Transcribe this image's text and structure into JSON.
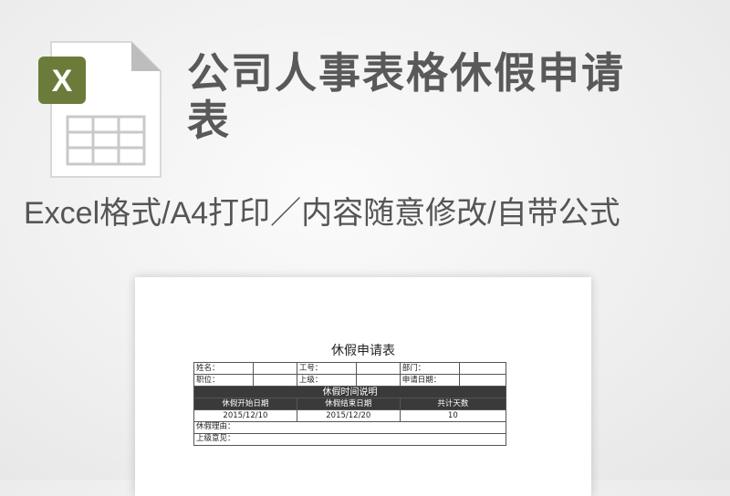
{
  "title": "公司人事表格休假申请表",
  "subtitle": "Excel格式/A4打印／内容随意修改/自带公式",
  "icon": {
    "letter": "X",
    "badge_color": "#6b7c3a"
  },
  "form": {
    "title": "休假申请表",
    "row1": {
      "name": "姓名：",
      "id": "工号：",
      "dept": "部门："
    },
    "row2": {
      "position": "职位：",
      "superior": "上级：",
      "apply_date": "申请日期："
    },
    "section": "休假时间说明",
    "headers": [
      "休假开始日期",
      "休假结束日期",
      "共计天数"
    ],
    "values": [
      "2015/12/10",
      "2015/12/20",
      "10"
    ],
    "reason": "休假理由：",
    "opinion": "上级意见："
  }
}
